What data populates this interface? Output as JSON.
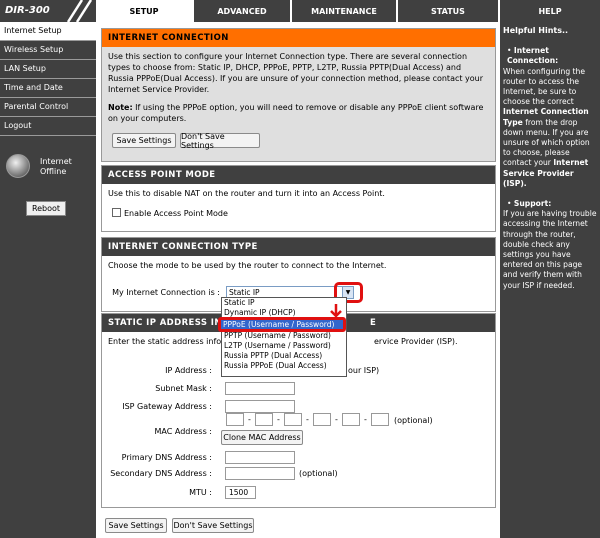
{
  "header": {
    "logo": "DIR-300",
    "tabs": [
      {
        "label": "SETUP"
      },
      {
        "label": "ADVANCED"
      },
      {
        "label": "MAINTENANCE"
      },
      {
        "label": "STATUS"
      },
      {
        "label": "HELP"
      }
    ]
  },
  "sidebar": {
    "items": [
      {
        "label": "Internet Setup"
      },
      {
        "label": "Wireless Setup"
      },
      {
        "label": "LAN Setup"
      },
      {
        "label": "Time and Date"
      },
      {
        "label": "Parental Control"
      },
      {
        "label": "Logout"
      }
    ],
    "status_line1": "Internet",
    "status_line2": "Offline",
    "reboot_label": "Reboot"
  },
  "internet_connection": {
    "title": "INTERNET CONNECTION",
    "description": "Use this section to configure your Internet Connection type. There are several connection types to choose from: Static IP, DHCP, PPPoE, PPTP, L2TP, Russia PPTP(Dual Access) and Russia PPPoE(Dual Access). If you are unsure of your connection method, please contact your Internet Service Provider.",
    "note_label": "Note:",
    "note_text": " If using the PPPoE option, you will need to remove or disable any PPPoE client software on your computers.",
    "save_label": "Save Settings",
    "dont_save_label": "Don't Save Settings"
  },
  "access_point": {
    "title": "ACCESS POINT MODE",
    "description": "Use this to disable NAT on the router and turn it into an Access Point.",
    "checkbox_label": "Enable Access Point Mode"
  },
  "connection_type": {
    "title": "INTERNET CONNECTION TYPE",
    "description": "Choose the mode to be used by the router to connect to the Internet.",
    "field_label": "My Internet Connection is :",
    "selected": "Static IP",
    "options": [
      "Static IP",
      "Dynamic IP (DHCP)",
      "PPPoE (Username / Password)",
      "PPTP (Username / Password)",
      "L2TP (Username / Password)",
      "Russia PPTP (Dual Access)",
      "Russia PPPoE (Dual Access)"
    ],
    "highlighted_option": "PPPoE (Username / Password)"
  },
  "static_ip": {
    "title_left": "STATIC IP ADDRESS IN",
    "title_right": "E",
    "description_left": "Enter the static address inform",
    "description_right": "ervice Provider (ISP).",
    "ip_label": "IP Address :",
    "ip_suffix": "our ISP)",
    "subnet_label": "Subnet Mask :",
    "gateway_label": "ISP Gateway Address :",
    "mac_label": "MAC Address :",
    "mac_optional": "(optional)",
    "clone_label": "Clone MAC Address",
    "dns1_label": "Primary DNS Address :",
    "dns2_label": "Secondary DNS Address :",
    "dns2_optional": "(optional)",
    "mtu_label": "MTU :",
    "mtu_value": "1500"
  },
  "footer": {
    "save_label": "Save Settings",
    "dont_save_label": "Don't Save Settings"
  },
  "hints": {
    "title": "Helpful Hints..",
    "h1_title": "Internet Connection:",
    "h1_text_a": "When configuring the router to access the Internet, be sure to choose the correct ",
    "h1_bold_a": "Internet Connection Type",
    "h1_text_b": " from the drop down menu. If you are unsure of which option to choose, please contact your ",
    "h1_bold_b": "Internet Service Provider (ISP).",
    "h2_title": "Support:",
    "h2_text": "If you are having trouble accessing the Internet through the router, double check any settings you have entered on this page and verify them with your ISP if needed."
  },
  "colors": {
    "dark_bg": "#404040",
    "orange_header": "#ff6f00",
    "highlight_red": "#e01010",
    "selection_blue": "#3366cc"
  },
  "icons": [
    "globe-icon",
    "dropdown-arrow-icon",
    "red-pointer-arrow-icon"
  ]
}
